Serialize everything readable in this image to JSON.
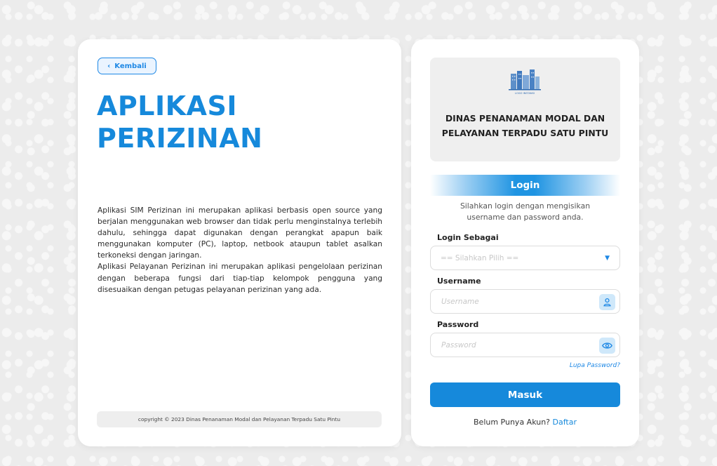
{
  "left": {
    "back_label": "Kembali",
    "title_line1": "APLIKASI",
    "title_line2": "PERIZINAN",
    "description_p1": "Aplikasi SIM Perizinan ini merupakan aplikasi berbasis open source yang berjalan menggunakan web browser dan tidak perlu menginstalnya terlebih dahulu, sehingga dapat digunakan dengan perangkat apapun baik menggunakan komputer (PC), laptop, netbook ataupun tablet asalkan terkoneksi dengan jaringan.",
    "description_p2": "Aplikasi Pelayanan Perizinan ini merupakan aplikasi pengelolaan perizinan dengan beberapa fungsi dari tiap-tiap kelompok pengguna yang disesuaikan dengan petugas pelayanan perizinan yang ada.",
    "copyright": "copyright © 2023 Dinas Penanaman Modal dan Pelayanan Terpadu Satu Pintu"
  },
  "right": {
    "logo_caption": "LOGO INSTANSI",
    "org_line1": "DINAS PENANAMAN MODAL DAN",
    "org_line2": "PELAYANAN TERPADU SATU PINTU",
    "login_heading": "Login",
    "login_sub_line1": "Silahkan login dengan mengisikan",
    "login_sub_line2": "username dan password anda.",
    "role_label": "Login Sebagai",
    "role_placeholder": "== Silahkan Pilih ==",
    "username_label": "Username",
    "username_placeholder": "Username",
    "password_label": "Password",
    "password_placeholder": "Password",
    "forgot_label": "Lupa Password?",
    "submit_label": "Masuk",
    "register_prompt": "Belum Punya Akun?",
    "register_link": "Daftar"
  },
  "icons": {
    "back": "chevron-left-icon",
    "select": "caret-down-icon",
    "username": "user-icon",
    "password": "eye-icon"
  },
  "colors": {
    "accent": "#1689db",
    "link": "#1e88e5",
    "icon_bg": "#cfe8fa"
  }
}
